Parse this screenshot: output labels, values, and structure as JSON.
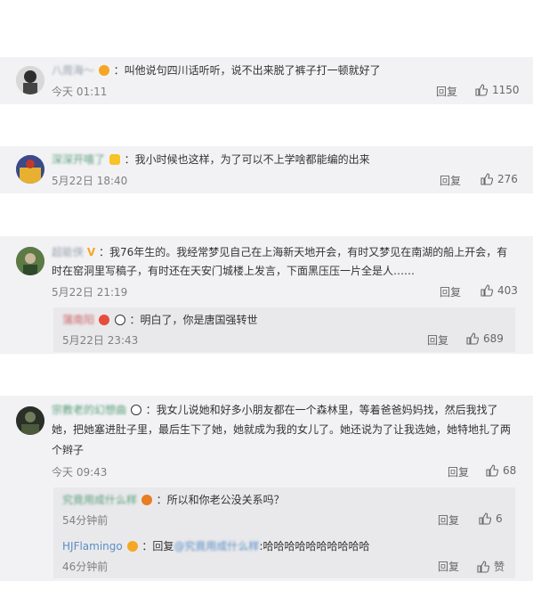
{
  "comments": [
    {
      "username": "八周海～",
      "text": "：叫他说句四川话听听，说不出来脱了裤子打一顿就好了",
      "time": "今天 01:11",
      "reply_label": "回复",
      "likes": "1150"
    },
    {
      "username": "深深开嘻了",
      "text": "：我小时候也这样，为了可以不上学啥都能编的出来",
      "time": "5月22日 18:40",
      "reply_label": "回复",
      "likes": "276"
    },
    {
      "username": "超能侠",
      "text_line1": "：我76年生的。我经常梦见自己在上海新天地开会，有时又梦见在南湖的船上开会，有",
      "text_line2": "时在窑洞里写稿子，有时还在天安门城楼上发言，下面黑压压一片全是人……",
      "time": "5月22日 21:19",
      "reply_label": "回复",
      "likes": "403",
      "sub": {
        "username": "蒲南阳",
        "text": "：明白了，你是唐国强转世",
        "time": "5月22日 23:43",
        "reply_label": "回复",
        "likes": "689"
      }
    },
    {
      "username": "宗教老的幻想曲",
      "text_line1": "：我女儿说她和好多小朋友都在一个森林里，等着爸爸妈妈找，然后我找了",
      "text_line2": "她，把她塞进肚子里，最后生下了她，她就成为我的女儿了。她还说为了让我选她，她特地扎了两",
      "text_line3": "个辫子",
      "time": "今天 09:43",
      "reply_label": "回复",
      "likes": "68",
      "subs": [
        {
          "username": "究竟用成什么样",
          "text": "：所以和你老公没关系吗？",
          "time": "54分钟前",
          "reply_label": "回复",
          "likes": "6"
        },
        {
          "username": "HJFlamingo",
          "text_prefix": "：回复",
          "mention": "@究竟用成什么样",
          "text": ":哈哈哈哈哈哈哈哈哈哈",
          "time": "46分钟前",
          "reply_label": "回复",
          "likes": "赞"
        }
      ]
    }
  ],
  "colors": {
    "card_bg": "#f2f2f5",
    "sub_bg": "#e9e9ec",
    "time": "#808080",
    "badge_orange": "#f5a623",
    "badge_gold": "#f7c325"
  },
  "icons": [
    "thumb-up-icon",
    "vip-badge-icon",
    "panda-emoji-icon"
  ]
}
